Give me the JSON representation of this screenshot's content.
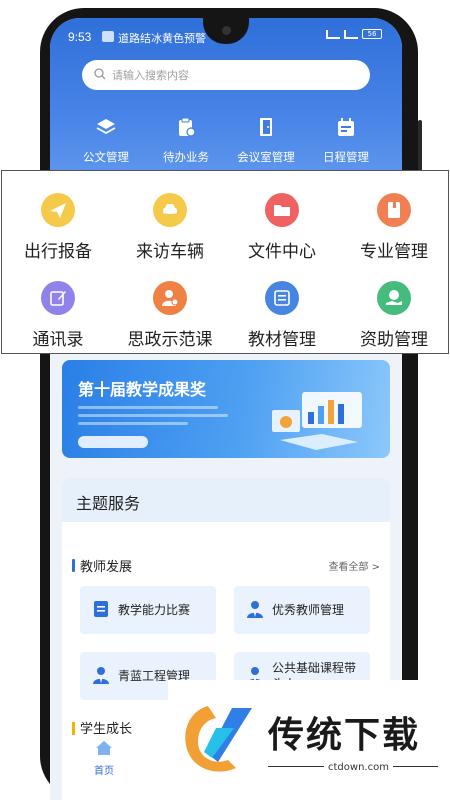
{
  "status": {
    "time": "9:53",
    "notification": "道路结冰黄色预警",
    "battery": "56"
  },
  "search": {
    "placeholder": "请输入搜索内容"
  },
  "quick_row": [
    {
      "label": "公文管理",
      "icon": "stack-icon"
    },
    {
      "label": "待办业务",
      "icon": "clipboard-icon"
    },
    {
      "label": "会议室管理",
      "icon": "door-icon"
    },
    {
      "label": "日程管理",
      "icon": "calendar-icon"
    }
  ],
  "overlay_grid": [
    {
      "label": "出行报备",
      "icon": "paper-plane-icon",
      "color": "#f5c842"
    },
    {
      "label": "来访车辆",
      "icon": "car-icon",
      "color": "#f5c842"
    },
    {
      "label": "文件中心",
      "icon": "folder-icon",
      "color": "#ef5a5a"
    },
    {
      "label": "专业管理",
      "icon": "book-icon",
      "color": "#f07a4a"
    },
    {
      "label": "通讯录",
      "icon": "edit-note-icon",
      "color": "#8a7ce8"
    },
    {
      "label": "思政示范课",
      "icon": "person-badge-icon",
      "color": "#f07a3a"
    },
    {
      "label": "教材管理",
      "icon": "list-icon",
      "color": "#3d7fe0"
    },
    {
      "label": "资助管理",
      "icon": "money-hand-icon",
      "color": "#3cb878"
    }
  ],
  "banner": {
    "title": "第十届教学成果奖"
  },
  "theme_section": {
    "title": "主题服务",
    "teacher_dev": {
      "label": "教师发展",
      "more": "查看全部 >",
      "tiles": [
        {
          "label": "教学能力比赛",
          "icon": "document-icon"
        },
        {
          "label": "优秀教师管理",
          "icon": "person-icon"
        },
        {
          "label": "青蓝工程管理",
          "icon": "person-icon"
        },
        {
          "label": "公共基础课程带头人",
          "icon": "person-icon"
        }
      ]
    },
    "student_growth": {
      "label": "学生成长"
    }
  },
  "tabbar": {
    "home": "首页"
  },
  "watermark": {
    "brand": "传统下载",
    "url": "ctdown.com"
  },
  "colors": {
    "primary": "#2f6fd9",
    "tile_bg": "#eaf3fd"
  }
}
